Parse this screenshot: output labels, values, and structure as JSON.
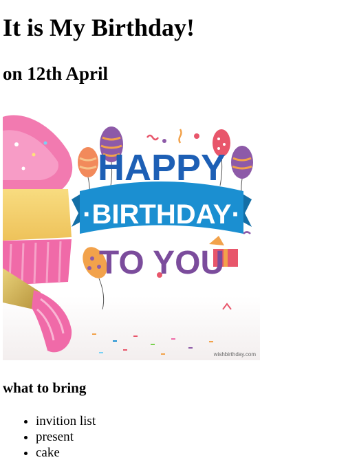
{
  "title": "It is My Birthday!",
  "subtitle": "on 12th April",
  "image": {
    "icon": "birthday-card-image",
    "banner_line1": "HAPPY",
    "banner_line2": "·BIRTHDAY·",
    "banner_line3": "TO YOU",
    "watermark": "wishbirthday.com",
    "colors": {
      "banner_blue": "#1b8fd1",
      "text_dark_blue": "#1d5fb5",
      "text_purple": "#7b4c9c",
      "frosting_pink": "#f27ab0",
      "cake_yellow": "#f5d26b",
      "cup_pink": "#f06aa8"
    }
  },
  "section": {
    "heading": "what to bring",
    "items": [
      {
        "label": "invition list"
      },
      {
        "label": "present"
      },
      {
        "label": "cake"
      }
    ]
  }
}
